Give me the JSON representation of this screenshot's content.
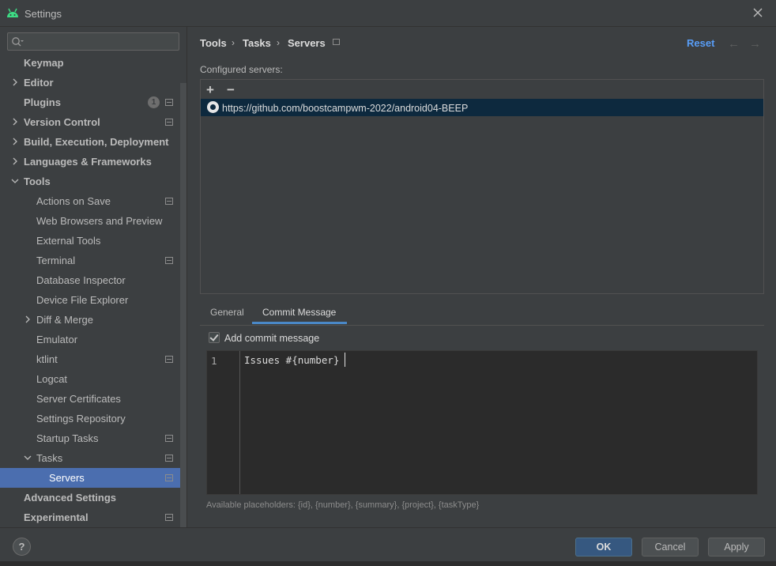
{
  "window": {
    "title": "Settings"
  },
  "search": {
    "placeholder": ""
  },
  "sidebar": {
    "items": [
      {
        "label": "Keymap",
        "bold": true,
        "indent": 0,
        "chevron": "none",
        "gear": false
      },
      {
        "label": "Editor",
        "bold": true,
        "indent": 0,
        "chevron": "right",
        "gear": false
      },
      {
        "label": "Plugins",
        "bold": true,
        "indent": 0,
        "chevron": "none",
        "gear": true,
        "badge": "1"
      },
      {
        "label": "Version Control",
        "bold": true,
        "indent": 0,
        "chevron": "right",
        "gear": true
      },
      {
        "label": "Build, Execution, Deployment",
        "bold": true,
        "indent": 0,
        "chevron": "right",
        "gear": false
      },
      {
        "label": "Languages & Frameworks",
        "bold": true,
        "indent": 0,
        "chevron": "right",
        "gear": false
      },
      {
        "label": "Tools",
        "bold": true,
        "indent": 0,
        "chevron": "down",
        "gear": false
      },
      {
        "label": "Actions on Save",
        "bold": false,
        "indent": 1,
        "chevron": "none",
        "gear": true
      },
      {
        "label": "Web Browsers and Preview",
        "bold": false,
        "indent": 1,
        "chevron": "none",
        "gear": false
      },
      {
        "label": "External Tools",
        "bold": false,
        "indent": 1,
        "chevron": "none",
        "gear": false
      },
      {
        "label": "Terminal",
        "bold": false,
        "indent": 1,
        "chevron": "none",
        "gear": true
      },
      {
        "label": "Database Inspector",
        "bold": false,
        "indent": 1,
        "chevron": "none",
        "gear": false
      },
      {
        "label": "Device File Explorer",
        "bold": false,
        "indent": 1,
        "chevron": "none",
        "gear": false
      },
      {
        "label": "Diff & Merge",
        "bold": false,
        "indent": 1,
        "chevron": "right",
        "gear": false
      },
      {
        "label": "Emulator",
        "bold": false,
        "indent": 1,
        "chevron": "none",
        "gear": false
      },
      {
        "label": "ktlint",
        "bold": false,
        "indent": 1,
        "chevron": "none",
        "gear": true
      },
      {
        "label": "Logcat",
        "bold": false,
        "indent": 1,
        "chevron": "none",
        "gear": false
      },
      {
        "label": "Server Certificates",
        "bold": false,
        "indent": 1,
        "chevron": "none",
        "gear": false
      },
      {
        "label": "Settings Repository",
        "bold": false,
        "indent": 1,
        "chevron": "none",
        "gear": false
      },
      {
        "label": "Startup Tasks",
        "bold": false,
        "indent": 1,
        "chevron": "none",
        "gear": true
      },
      {
        "label": "Tasks",
        "bold": false,
        "indent": 1,
        "chevron": "down",
        "gear": true
      },
      {
        "label": "Servers",
        "bold": false,
        "indent": 2,
        "chevron": "none",
        "gear": true,
        "selected": true
      },
      {
        "label": "Advanced Settings",
        "bold": true,
        "indent": 0,
        "chevron": "none",
        "gear": false
      },
      {
        "label": "Experimental",
        "bold": true,
        "indent": 0,
        "chevron": "none",
        "gear": true
      }
    ]
  },
  "breadcrumb": {
    "items": [
      "Tools",
      "Tasks",
      "Servers"
    ]
  },
  "header": {
    "reset_label": "Reset",
    "back_arrow": "←",
    "forward_arrow": "→"
  },
  "servers": {
    "label": "Configured servers:",
    "add_label": "+",
    "remove_label": "−",
    "entries": [
      "https://github.com/boostcampwm-2022/android04-BEEP"
    ]
  },
  "tabs": {
    "general": "General",
    "commit_message": "Commit Message",
    "active": "commit_message"
  },
  "commit": {
    "checkbox_label": "Add commit message",
    "checked": true,
    "line_number": "1",
    "text": "Issues #{number}",
    "placeholders": "Available placeholders: {id}, {number}, {summary}, {project}, {taskType}"
  },
  "footer": {
    "help_label": "?",
    "ok_label": "OK",
    "cancel_label": "Cancel",
    "apply_label": "Apply"
  },
  "colors": {
    "accent": "#4b6eaf",
    "link": "#589df6",
    "selected_row": "#0d293e",
    "ok_button": "#365880"
  }
}
